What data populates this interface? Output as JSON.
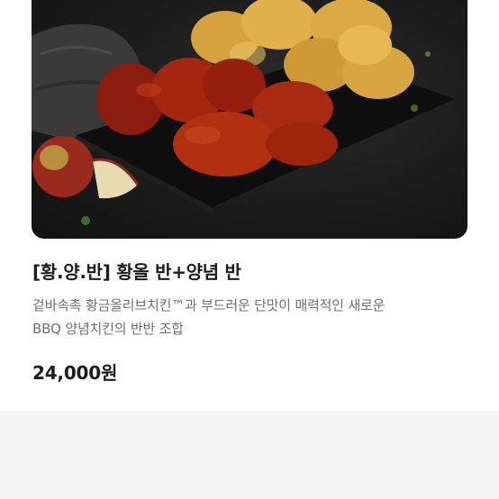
{
  "product": {
    "title": "[황.양.반] 황올 반+양념 반",
    "description_line1": "겉바속촉 황금올리브치킨™과 부드러운 단맛이 매력적인 새로운",
    "description_line2": "BBQ 양념치킨의 반반 조합",
    "price": "24,000원",
    "image_icon": "fried-chicken-photo"
  },
  "colors": {
    "title": "#1c1c1c",
    "description": "#6f6f6f",
    "price": "#1c1c1c",
    "page_background": "#f5f5f5"
  }
}
